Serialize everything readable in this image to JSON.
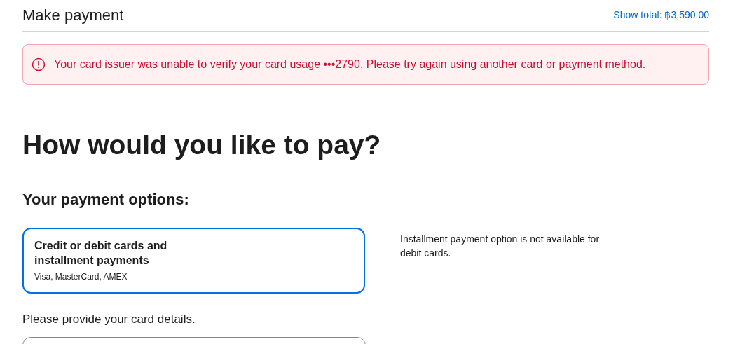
{
  "header": {
    "title": "Make payment",
    "total_link": "Show total: ฿3,590.00"
  },
  "error": {
    "message": "Your card issuer was unable to verify your card usage •••2790. Please try again using another card or payment method."
  },
  "heading": "How would you like to pay?",
  "options_heading": "Your payment options:",
  "options": [
    {
      "title": "Credit or debit cards and installment payments",
      "subtitle": "Visa, MasterCard, AMEX",
      "selected": true
    }
  ],
  "note": "Installment payment option is not available for debit cards.",
  "card_prompt": "Please provide your card details."
}
